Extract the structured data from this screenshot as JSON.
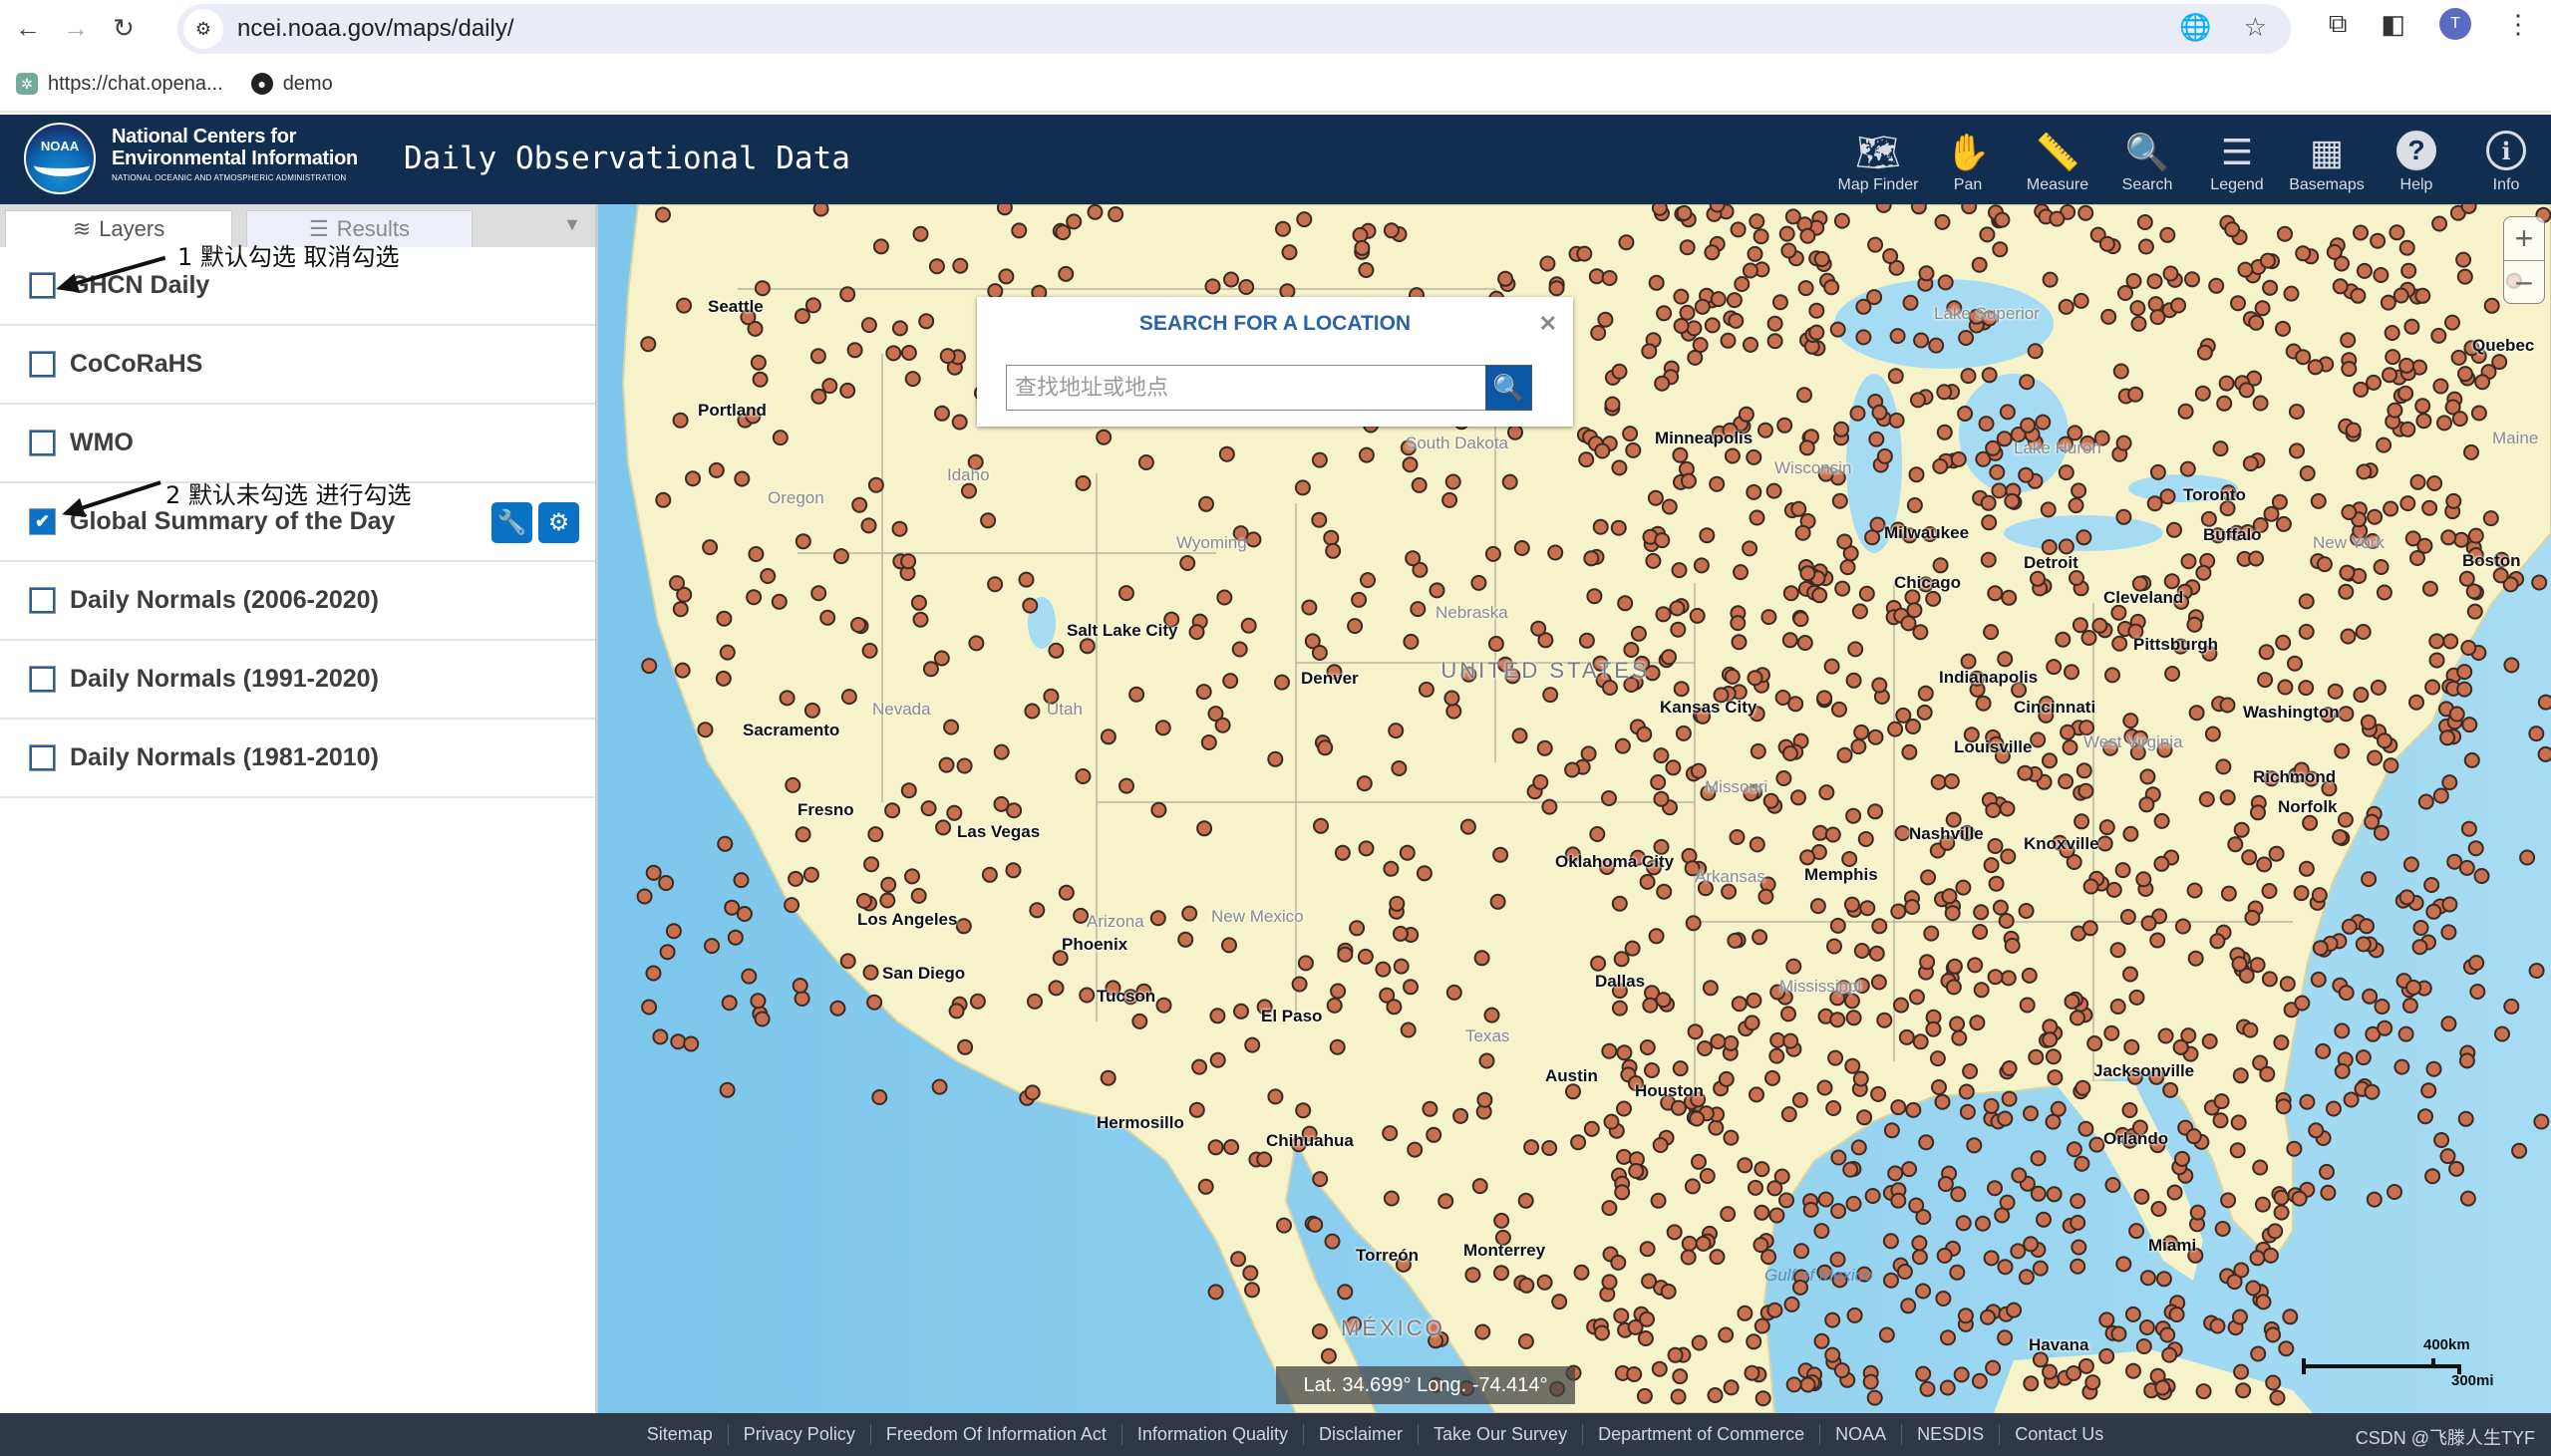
{
  "browser": {
    "url": "ncei.noaa.gov/maps/daily/",
    "profile_initial": "T",
    "bookmarks": [
      {
        "label": "https://chat.opena...",
        "icon": "openai-icon"
      },
      {
        "label": "demo",
        "icon": "github-icon"
      }
    ]
  },
  "header": {
    "logo_text": "NOAA",
    "org_line1": "National Centers for",
    "org_line2": "Environmental Information",
    "org_line3": "NATIONAL OCEANIC AND ATMOSPHERIC ADMINISTRATION",
    "app_title": "Daily Observational Data",
    "tools": [
      {
        "label": "Map Finder",
        "icon": "map-finder-icon"
      },
      {
        "label": "Pan",
        "icon": "hand-icon"
      },
      {
        "label": "Measure",
        "icon": "ruler-icon"
      },
      {
        "label": "Search",
        "icon": "search-icon"
      },
      {
        "label": "Legend",
        "icon": "list-icon"
      },
      {
        "label": "Basemaps",
        "icon": "basemaps-icon"
      },
      {
        "label": "Help",
        "icon": "help-icon"
      },
      {
        "label": "Info",
        "icon": "info-icon"
      }
    ]
  },
  "sidebar": {
    "tabs": [
      {
        "label": "Layers",
        "active": true
      },
      {
        "label": "Results",
        "active": false
      }
    ],
    "layers": [
      {
        "label": "GHCN Daily",
        "checked": false
      },
      {
        "label": "CoCoRaHS",
        "checked": false
      },
      {
        "label": "WMO",
        "checked": false
      },
      {
        "label": "Global Summary of the Day",
        "checked": true
      },
      {
        "label": "Daily Normals (2006-2020)",
        "checked": false
      },
      {
        "label": "Daily Normals (1991-2020)",
        "checked": false
      },
      {
        "label": "Daily Normals (1981-2010)",
        "checked": false
      }
    ],
    "annotations": [
      "1 默认勾选 取消勾选",
      "2 默认未勾选 进行勾选"
    ]
  },
  "search_dialog": {
    "title": "SEARCH FOR A LOCATION",
    "placeholder": "查找地址或地点",
    "value": ""
  },
  "map": {
    "coordinates": "Lat. 34.699°  Long. -74.414°",
    "scale_km": "400km",
    "scale_mi": "300mi",
    "marker_color": "#c8704f",
    "labels": {
      "cities": [
        "Seattle",
        "Portland",
        "Minneapolis",
        "Milwaukee",
        "Chicago",
        "Detroit",
        "Toronto",
        "Buffalo",
        "Boston",
        "Quebec",
        "Cleveland",
        "Pittsburgh",
        "Salt Lake City",
        "Denver",
        "Kansas City",
        "Indianapolis",
        "Cincinnati",
        "Louisville",
        "Sacramento",
        "Fresno",
        "Las Vegas",
        "Los Angeles",
        "San Diego",
        "Phoenix",
        "Tucson",
        "El Paso",
        "Oklahoma City",
        "Memphis",
        "Nashville",
        "Knoxville",
        "Richmond",
        "Norfolk",
        "Washington",
        "Dallas",
        "Austin",
        "Houston",
        "Jacksonville",
        "Orlando",
        "Miami",
        "Havana",
        "Hermosillo",
        "Chihuahua",
        "Monterrey",
        "Torreón"
      ],
      "regions": [
        "South Dakota",
        "Oregon",
        "Idaho",
        "Wyoming",
        "Nebraska",
        "Nevada",
        "Utah",
        "Arizona",
        "New Mexico",
        "Texas",
        "Missouri",
        "Arkansas",
        "Mississippi",
        "West Virginia",
        "New York",
        "Wisconsin",
        "Maine",
        "Lake Superior",
        "Lake Huron"
      ],
      "countries": [
        "UNITED STATES",
        "MÉXICO"
      ],
      "water": [
        "Gulf of Mexico"
      ]
    }
  },
  "footer": {
    "links": [
      "Sitemap",
      "Privacy Policy",
      "Freedom Of Information Act",
      "Information Quality",
      "Disclaimer",
      "Take Our Survey",
      "Department of Commerce",
      "NOAA",
      "NESDIS",
      "Contact Us"
    ],
    "watermark": "CSDN @飞滕人生TYF"
  }
}
